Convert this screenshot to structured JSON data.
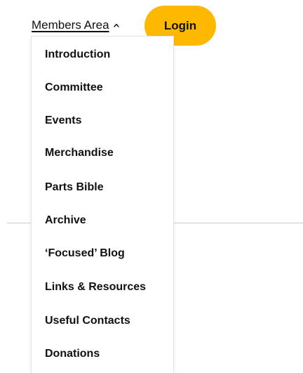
{
  "nav": {
    "members_label": "Members Area",
    "login_label": "Login"
  },
  "dropdown": {
    "items": [
      "Introduction",
      "Committee",
      "Events",
      "Merchandise",
      "Parts Bible",
      "Archive",
      "‘Focused’ Blog",
      "Links & Resources",
      "Useful Contacts",
      "Donations"
    ]
  },
  "colors": {
    "login_button": "#FFB800",
    "text": "#111111",
    "divider": "#cfcfcf"
  },
  "icons": {
    "members_caret": "chevron-up-icon"
  }
}
